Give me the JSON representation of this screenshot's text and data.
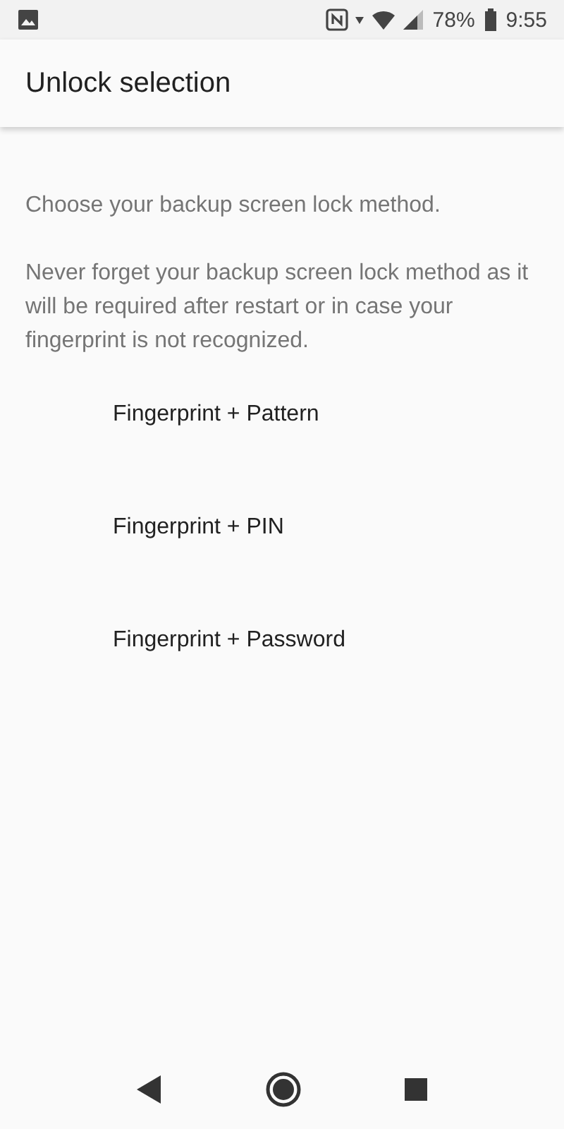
{
  "status_bar": {
    "battery_text": "78%",
    "time": "9:55"
  },
  "header": {
    "title": "Unlock selection"
  },
  "intro": "Choose your backup screen lock method.",
  "warning": "Never forget your backup screen lock method as it will be required after restart or in case your fingerprint is not recognized.",
  "options": [
    {
      "label": "Fingerprint + Pattern"
    },
    {
      "label": "Fingerprint + PIN"
    },
    {
      "label": "Fingerprint + Password"
    }
  ]
}
